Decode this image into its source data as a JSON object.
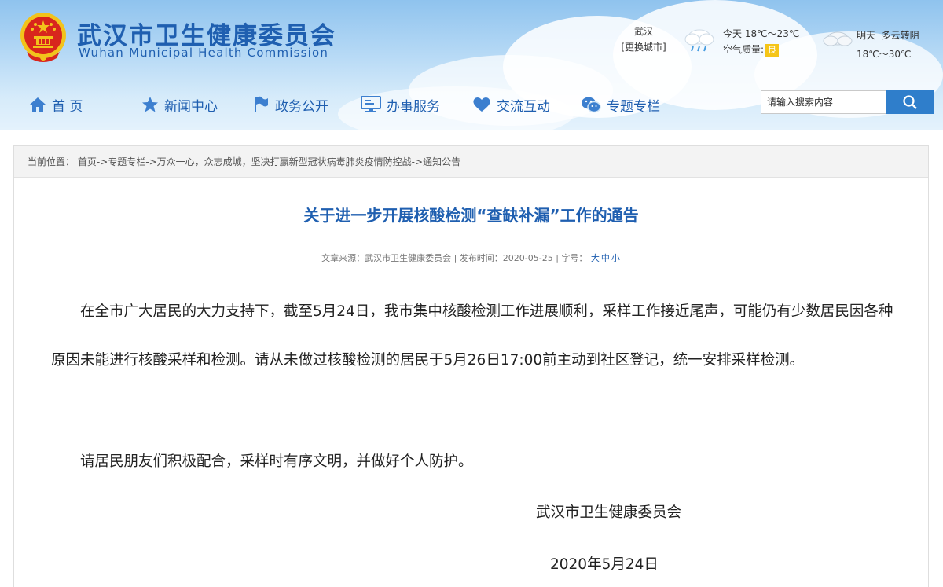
{
  "site": {
    "name_cn": "武汉市卫生健康委员会",
    "name_en": "Wuhan Municipal Health Commission"
  },
  "weather": {
    "city": "武汉",
    "change_city": "[更换城市]",
    "today": "今天 18℃～23℃",
    "air_quality_label": "空气质量:",
    "air_quality_value": "良",
    "tomorrow": "明天  多云转阴",
    "tomorrow_temp": "18℃～30℃"
  },
  "nav": {
    "items": [
      {
        "label": "首 页",
        "icon": "home-icon"
      },
      {
        "label": "新闻中心",
        "icon": "star-icon"
      },
      {
        "label": "政务公开",
        "icon": "flag-icon"
      },
      {
        "label": "办事服务",
        "icon": "monitor-icon"
      },
      {
        "label": "交流互动",
        "icon": "heart-icon"
      },
      {
        "label": "专题专栏",
        "icon": "wechat-icon"
      }
    ]
  },
  "search": {
    "placeholder": "请输入搜索内容",
    "icon": "search-icon"
  },
  "breadcrumb": {
    "label": "当前位置：",
    "items": [
      "首页",
      "专题专栏",
      "万众一心，众志成城，坚决打赢新型冠状病毒肺炎疫情防控战",
      "通知公告"
    ]
  },
  "article": {
    "title": "关于进一步开展核酸检测“查缺补漏”工作的通告",
    "meta": {
      "source_label": "文章来源：",
      "source": "武汉市卫生健康委员会",
      "date_label": "发布时间：",
      "date": "2020-05-25",
      "font_label": "字号：",
      "font_sizes": [
        "大",
        "中",
        "小"
      ]
    },
    "paragraphs": [
      "在全市广大居民的大力支持下，截至5月24日，我市集中核酸检测工作进展顺利，采样工作接近尾声，可能仍有少数居民因各种原因未能进行核酸采样和检测。请从未做过核酸检测的居民于5月26日17:00前主动到社区登记，统一安排采样检测。",
      "请居民朋友们积极配合，采样时有序文明，并做好个人防护。"
    ],
    "signature_org": "武汉市卫生健康委员会",
    "signature_date": "2020年5月24日"
  },
  "colors": {
    "brand_blue": "#1f5fb0",
    "search_button": "#2f7ecb",
    "aq_badge": "#f5c518",
    "emblem_red": "#d8251d",
    "emblem_gold": "#f2c31b"
  }
}
